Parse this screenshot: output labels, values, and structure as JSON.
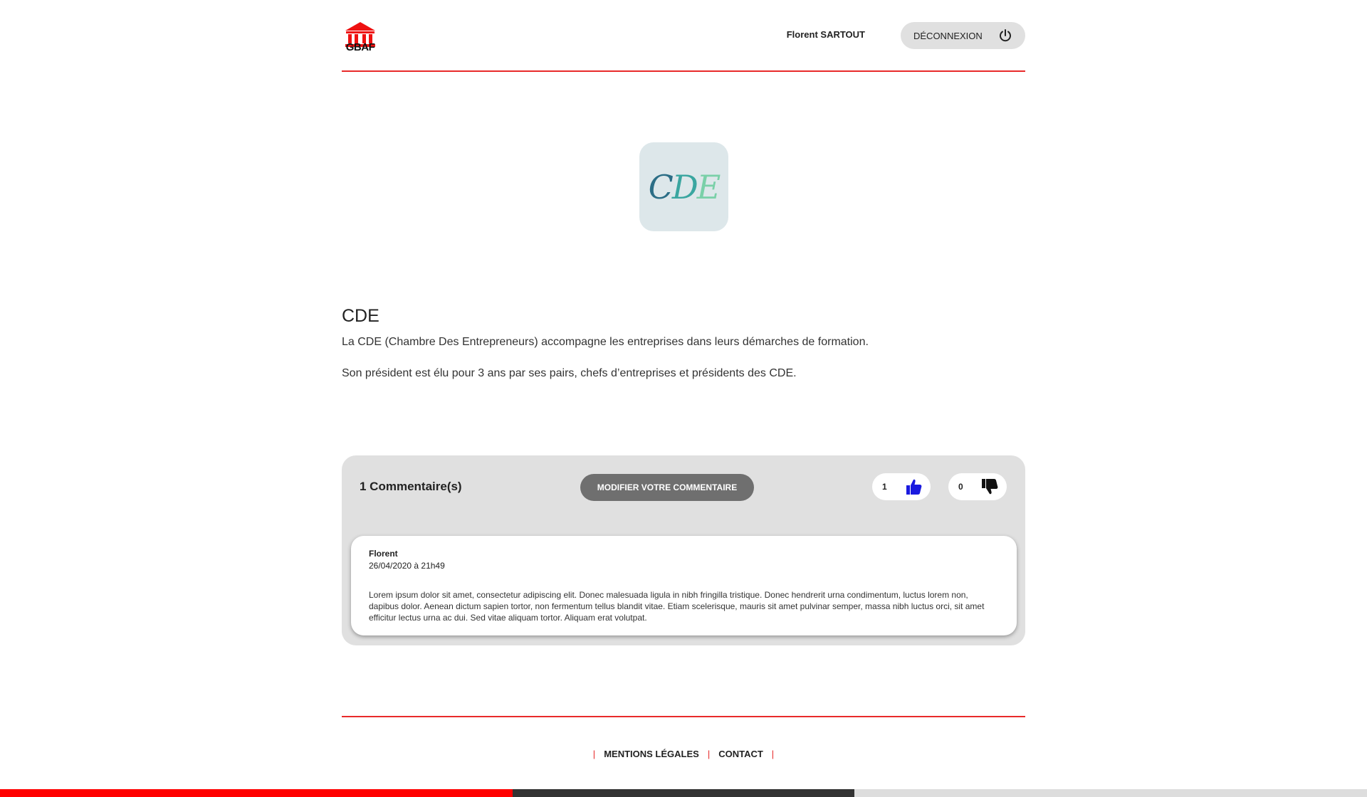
{
  "header": {
    "logo_text": "GBAF",
    "user_name": "Florent SARTOUT",
    "logout_label": "DÉCONNEXION"
  },
  "partner": {
    "logo_letters": [
      "C",
      "D",
      "E"
    ],
    "name": "CDE",
    "paragraphs": [
      "La CDE (Chambre Des Entrepreneurs) accompagne les entreprises dans leurs démarches de formation.",
      "Son président est élu pour 3 ans par ses pairs, chefs d’entreprises et présidents des CDE."
    ]
  },
  "comments_panel": {
    "count_label": "1 Commentaire(s)",
    "edit_button_label": "MODIFIER VOTRE COMMENTAIRE",
    "likes": "1",
    "dislikes": "0",
    "comments": [
      {
        "author": "Florent",
        "date": "26/04/2020 à 21h49",
        "text": "Lorem ipsum dolor sit amet, consectetur adipiscing elit. Donec malesuada ligula in nibh fringilla tristique. Donec hendrerit urna condimentum, luctus lorem non, dapibus dolor. Aenean dictum sapien tortor, non fermentum tellus blandit vitae. Etiam scelerisque, mauris sit amet pulvinar semper, massa nibh luctus orci, sit amet efficitur lectus urna ac dui. Sed vitae aliquam tortor. Aliquam erat volutpat."
      }
    ]
  },
  "footer": {
    "separator": "|",
    "legal_label": "MENTIONS LÉGALES",
    "contact_label": "CONTACT"
  },
  "colors": {
    "accent": "#e82a2a",
    "like_icon": "#1a1adf",
    "bar_segments": [
      "#ff0000",
      "#333333",
      "#dddddd"
    ]
  },
  "icons": {
    "logo": "bank-building-icon",
    "logout": "power-icon",
    "like": "thumbs-up-icon",
    "dislike": "thumbs-down-icon"
  }
}
